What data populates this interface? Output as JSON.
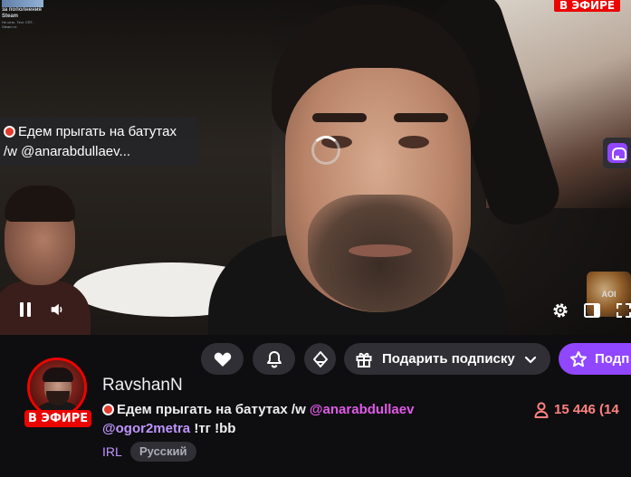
{
  "player": {
    "live_badge": "В ЭФИРЕ",
    "overlay": {
      "line1": "за пополнения Steam",
      "line2": "Не сеть. Тест CRT-Steam ст."
    },
    "title_tooltip": {
      "line1": "Едем прыгать на батутах",
      "line2": "/w @anarabdullaev..."
    },
    "corner_logo_text": "AOI",
    "controls": [
      "pause",
      "volume",
      "settings",
      "theatre",
      "fullscreen"
    ]
  },
  "actions": {
    "gift_label": "Подарить подписку",
    "subscribe_label": "Подп"
  },
  "channel": {
    "name": "RavshanN",
    "live_badge": "В ЭФИРЕ",
    "title_text": "Едем прыгать на батутах /w ",
    "title_mention1": "@anarabdullaev",
    "title_mention2": "@ogor2metra",
    "title_rest": " !тг !bb",
    "viewers": "15 446 (14",
    "category": "IRL",
    "tag": "Русский"
  },
  "colors": {
    "accent": "#9147ff",
    "live": "#eb0400",
    "viewers": "#ff8280",
    "link": "#bf94ff",
    "mention_pink": "#e05ae7",
    "button_bg": "#2f2f35",
    "background": "#0e0e10"
  },
  "icons": [
    "heart-icon",
    "bell-icon",
    "prime-crown-icon",
    "gift-icon",
    "chevron-down-icon",
    "star-icon",
    "person-icon",
    "pause-icon",
    "volume-icon",
    "gear-icon",
    "theatre-icon",
    "fullscreen-icon",
    "extension-icon"
  ]
}
